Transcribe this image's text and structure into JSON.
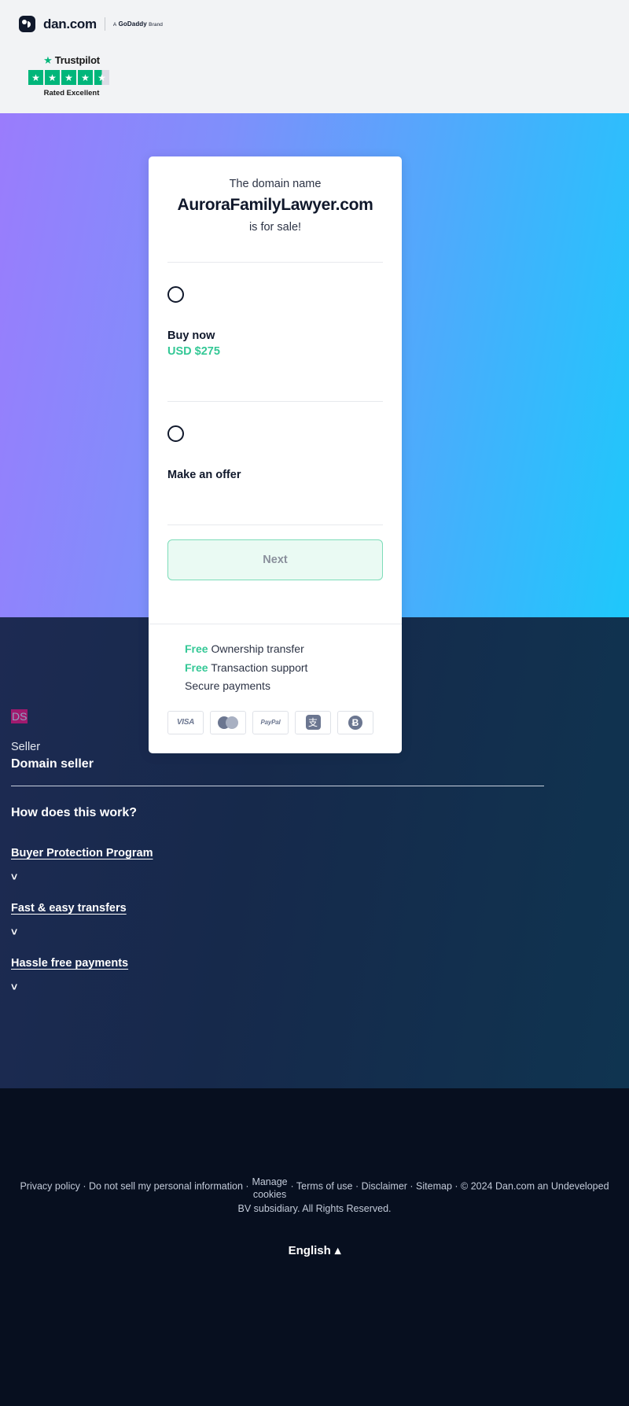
{
  "header": {
    "logo_text": "dan.com",
    "brand_prefix": "A",
    "brand_name": "GoDaddy",
    "brand_suffix": "Brand",
    "trustpilot": {
      "name": "Trustpilot",
      "rated": "Rated Excellent",
      "stars": 4.5,
      "star_color": "#00b67a"
    }
  },
  "card": {
    "pre_text": "The domain name",
    "domain": "AuroraFamilyLawyer.com",
    "post_text": "is for sale!",
    "options": [
      {
        "label": "Buy now",
        "price": "USD $275",
        "selected": false
      },
      {
        "label": "Make an offer",
        "price": "",
        "selected": false
      }
    ],
    "next_label": "Next",
    "features": [
      {
        "free": "Free",
        "text": "Ownership transfer"
      },
      {
        "free": "Free",
        "text": "Transaction support"
      },
      {
        "free": "",
        "text": "Secure payments"
      }
    ],
    "payments": [
      {
        "name": "visa-logo",
        "label": "VISA"
      },
      {
        "name": "mastercard-logo",
        "label": ""
      },
      {
        "name": "paypal-logo",
        "label": "PayPal"
      },
      {
        "name": "alipay-logo",
        "label": "支"
      },
      {
        "name": "bitcoin-logo",
        "label": "Ƀ"
      }
    ]
  },
  "seller": {
    "initials": "DS",
    "label": "Seller",
    "name": "Domain seller"
  },
  "info": {
    "title": "How does this work?",
    "items": [
      {
        "title": "Buyer Protection Program",
        "chevron": "⌄"
      },
      {
        "title": "Fast & easy transfers",
        "chevron": "⌄"
      },
      {
        "title": "Hassle free payments",
        "chevron": "⌄"
      }
    ]
  },
  "footer": {
    "links": [
      "Privacy policy",
      "Do not sell my personal information",
      "Manage cookies",
      "Terms of use",
      "Disclaimer",
      "Sitemap"
    ],
    "copyright": "© 2024 Dan.com an Undeveloped BV subsidiary. All Rights Reserved.",
    "language": "English",
    "language_caret": "▴"
  },
  "colors": {
    "accent_green": "#34c896",
    "hero_left": "#9a7cfc",
    "hero_right": "#1ec8fb",
    "trustpilot_green": "#00b67a",
    "dark_navy": "#0a1628"
  }
}
